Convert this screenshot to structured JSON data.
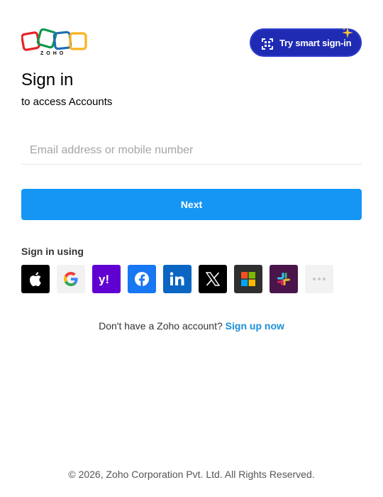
{
  "logo": {
    "text": "ZOHO",
    "colors": [
      "#e42527",
      "#089949",
      "#226db4",
      "#f9b21d"
    ]
  },
  "smart_signin": {
    "label": "Try smart sign-in",
    "background": "#1f2bb3",
    "icon": "qr-scan-icon"
  },
  "heading": {
    "title": "Sign in",
    "subtitle": "to access Accounts"
  },
  "email": {
    "placeholder": "Email address or mobile number",
    "value": ""
  },
  "next_button": {
    "label": "Next",
    "color": "#1596f5"
  },
  "sign_in_using": {
    "label": "Sign in using",
    "providers": [
      {
        "name": "apple",
        "icon": "apple-icon",
        "background": "#000000"
      },
      {
        "name": "google",
        "icon": "google-icon",
        "background": "#f2f2f2"
      },
      {
        "name": "yahoo",
        "icon": "yahoo-icon",
        "background": "#6001d2"
      },
      {
        "name": "facebook",
        "icon": "facebook-icon",
        "background": "#1877f2"
      },
      {
        "name": "linkedin",
        "icon": "linkedin-icon",
        "background": "#0a66c2"
      },
      {
        "name": "x",
        "icon": "x-icon",
        "background": "#000000"
      },
      {
        "name": "microsoft",
        "icon": "microsoft-icon",
        "background": "#2f2f2f"
      },
      {
        "name": "slack",
        "icon": "slack-icon",
        "background": "#4a154b"
      },
      {
        "name": "more",
        "icon": "more-icon",
        "background": "#f2f2f2"
      }
    ]
  },
  "signup": {
    "prompt": "Don't have a Zoho account?",
    "link_label": "Sign up now",
    "link_color": "#1a8fd8"
  },
  "footer": {
    "copyright": "© 2026, Zoho Corporation Pvt. Ltd. All Rights Reserved."
  }
}
